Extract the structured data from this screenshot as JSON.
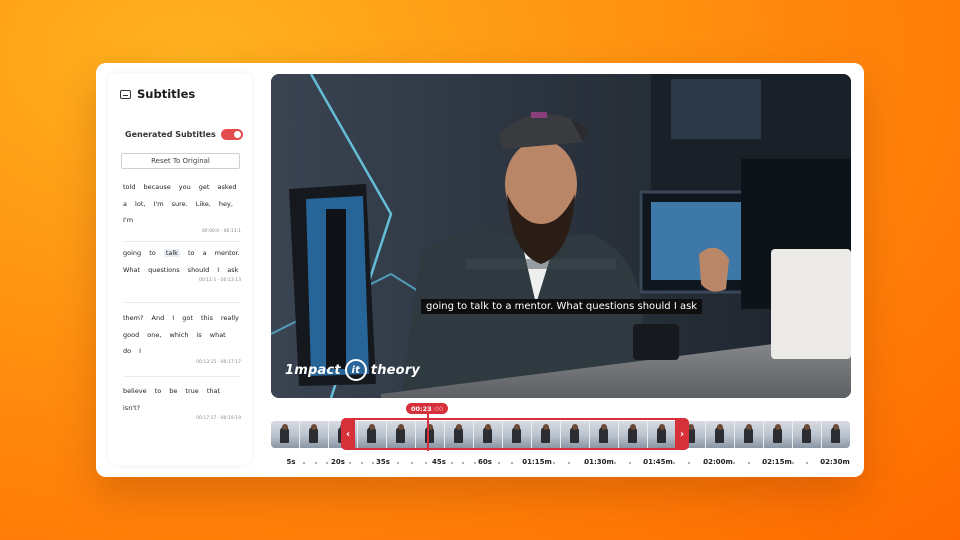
{
  "sidebar": {
    "title": "Subtitles",
    "generated_label": "Generated Subtitles",
    "reset_label": "Reset To Original",
    "segments": [
      {
        "text_html": "told because you get asked a lot, I'm sure. Like, hey, I'm",
        "time": "00:00:0 - 00:11:1"
      },
      {
        "text_html": "going to <span class=\"hl\">talk</span> to a mentor. What questions should I ask",
        "time": "00:11:1 - 00:13:13"
      },
      {
        "text_html": "them? And I got this really good one, which is what do I",
        "time": "00:13:15 - 00:17:17"
      },
      {
        "text_html": "believe to be true that isn't?",
        "time": "00:17:17 - 00:19:19"
      }
    ]
  },
  "video": {
    "caption": "going to talk to a mentor. What questions should I ask",
    "logo_left": "1mpact",
    "logo_mark": "it",
    "logo_right": "theory"
  },
  "timeline": {
    "playhead_time": "00:23",
    "playhead_fraction": ":00",
    "prev_icon": "chevron-left-icon",
    "next_icon": "chevron-right-icon",
    "ticks": [
      "5s",
      "20s",
      "35s",
      "45s",
      "60s",
      "01:15m",
      "01:30m",
      "01:45m",
      "02:00m",
      "02:15m",
      "02:30m"
    ]
  },
  "colors": {
    "accent": "#d6303a",
    "toggle_on": "#e34d4d",
    "background_start": "#ffb21f",
    "background_end": "#ff6a00"
  }
}
